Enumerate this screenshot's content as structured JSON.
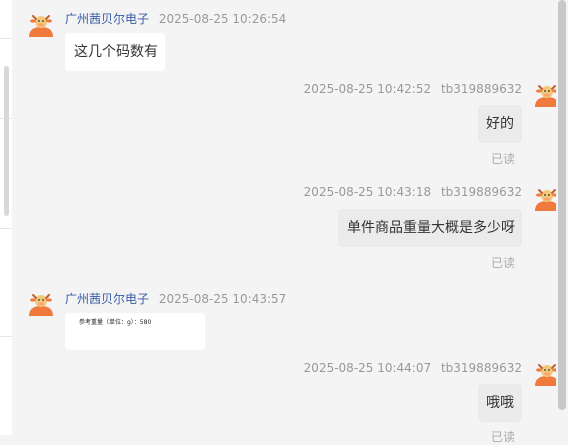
{
  "messages": [
    {
      "side": "left",
      "sender": "广州茜贝尔电子",
      "time": "2025-08-25 10:26:54",
      "text": "这几个码数有"
    },
    {
      "side": "right",
      "time": "2025-08-25 10:42:52",
      "user": "tb319889632",
      "text": "好的",
      "status": "已读"
    },
    {
      "side": "right",
      "time": "2025-08-25 10:43:18",
      "user": "tb319889632",
      "text": "单件商品重量大概是多少呀",
      "status": "已读"
    },
    {
      "side": "left",
      "sender": "广州茜贝尔电子",
      "time": "2025-08-25 10:43:57",
      "image_text": "参考重量（单位：g）：580"
    },
    {
      "side": "right",
      "time": "2025-08-25 10:44:07",
      "user": "tb319889632",
      "text": "哦哦",
      "status": "已读"
    }
  ],
  "avatar_icon": "cartoon-cow-avatar",
  "colors": {
    "background": "#f4f4f4",
    "sender_name": "#3a5ba8",
    "timestamp": "#999999",
    "avatar_orange": "#f07a3c"
  }
}
